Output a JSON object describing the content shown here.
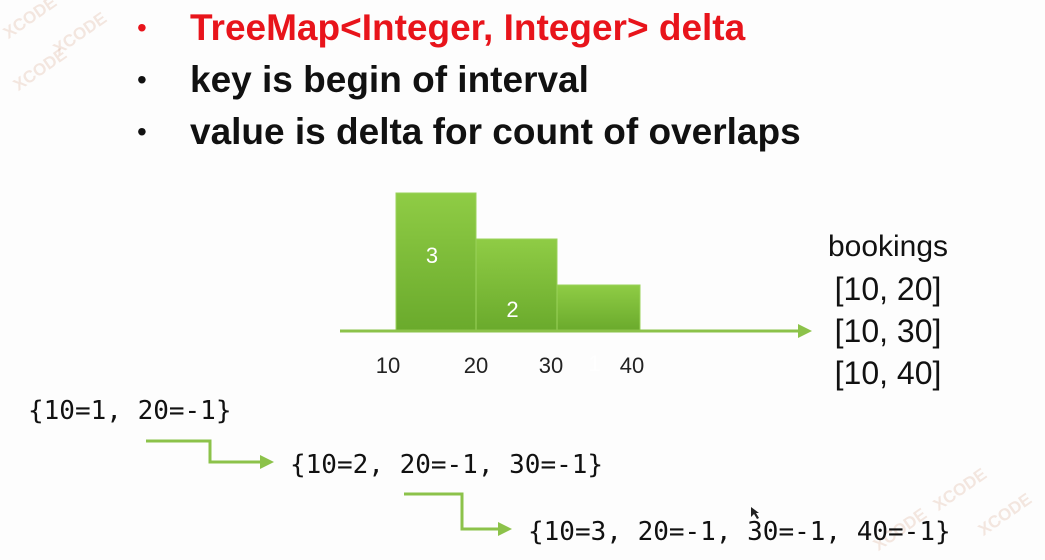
{
  "bullets": [
    {
      "text": "TreeMap<Integer, Integer> delta",
      "highlight": true
    },
    {
      "text": "key is begin of interval",
      "highlight": false
    },
    {
      "text": "value is delta for count of overlaps",
      "highlight": false
    }
  ],
  "bullet_glyph": "•",
  "histogram": {
    "ticks": [
      "10",
      "20",
      "30",
      "40"
    ],
    "bars": [
      {
        "from": 10,
        "to": 20,
        "count": 3
      },
      {
        "from": 20,
        "to": 30,
        "count": 2
      },
      {
        "from": 30,
        "to": 40,
        "count": 1
      }
    ],
    "bar_color": "#7fbf3a",
    "axis_color": "#8cc24a"
  },
  "bookings": {
    "title": "bookings",
    "items": [
      "[10, 20]",
      "[10, 30]",
      "[10, 40]"
    ]
  },
  "map_states": [
    "{10=1, 20=-1}",
    "{10=2, 20=-1, 30=-1}",
    "{10=3, 20=-1, 30=-1, 40=-1}"
  ],
  "colors": {
    "highlight": "#e8141b",
    "arrow": "#8cc24a",
    "text": "#111111"
  },
  "watermark": "XCODE"
}
